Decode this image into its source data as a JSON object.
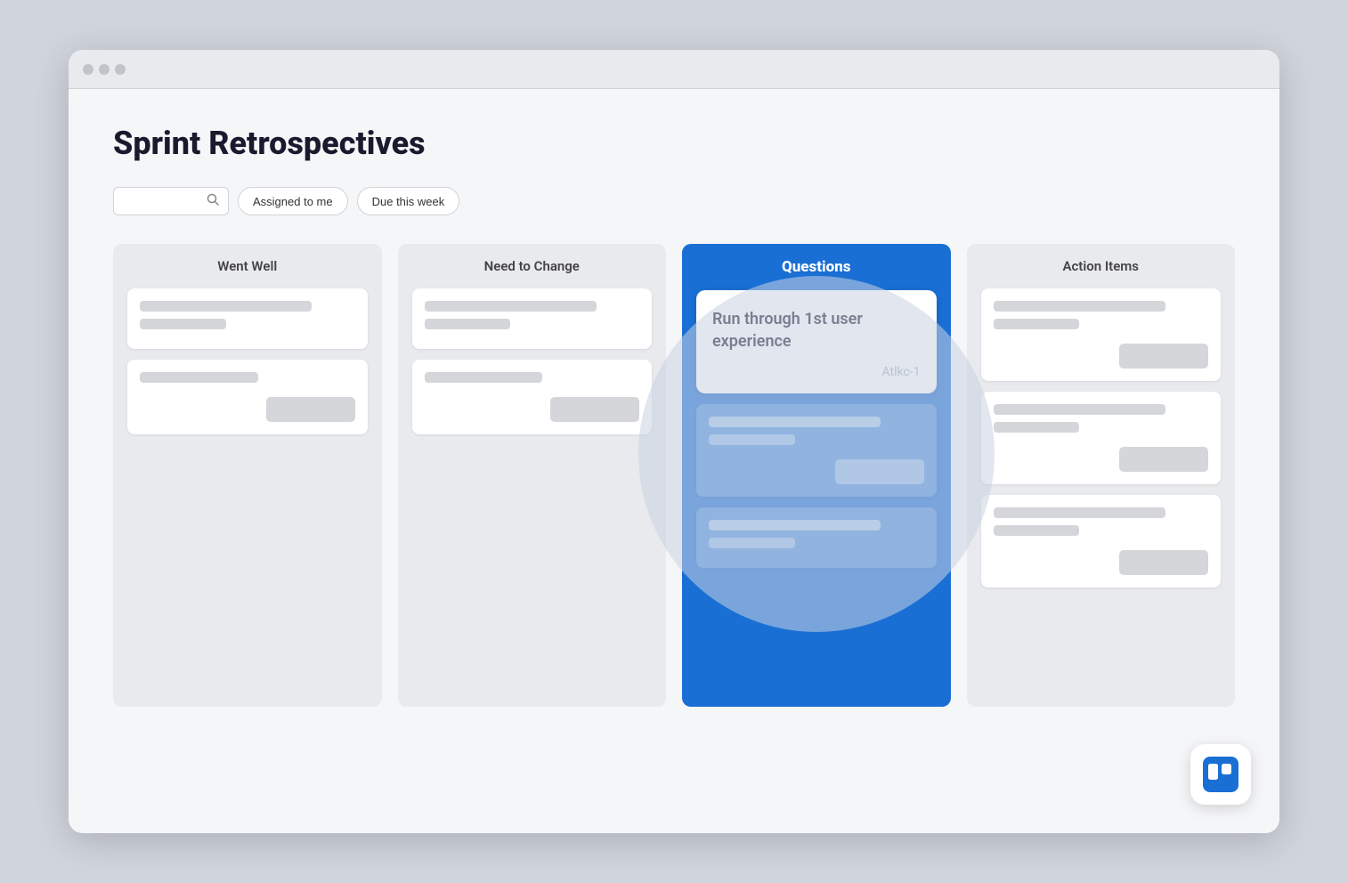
{
  "browser": {
    "dots": [
      "dot1",
      "dot2",
      "dot3"
    ]
  },
  "page": {
    "title": "Sprint Retrospectives"
  },
  "filters": {
    "search_placeholder": "Search",
    "assigned_label": "Assigned to me",
    "due_label": "Due this week"
  },
  "columns": {
    "went_well": {
      "header": "Went Well",
      "cards": [
        {
          "lines": [
            "long",
            "short"
          ],
          "has_btn": false
        },
        {
          "lines": [
            "medium"
          ],
          "has_btn": true
        }
      ]
    },
    "need_to_change": {
      "header": "Need to Change",
      "cards": [
        {
          "lines": [
            "long",
            "short"
          ],
          "has_btn": false
        },
        {
          "lines": [
            "medium"
          ],
          "has_btn": true
        }
      ]
    },
    "questions": {
      "header": "Questions",
      "featured_card": {
        "title": "Run through 1st user experience",
        "id": "Atlkc-1"
      },
      "cards": [
        {
          "lines": [
            "long",
            "short"
          ],
          "has_btn": true
        },
        {
          "lines": [
            "long",
            "short"
          ],
          "has_btn": false
        }
      ]
    },
    "action_items": {
      "header": "Action Items",
      "cards": [
        {
          "lines": [
            "long",
            "short"
          ],
          "has_btn": true
        },
        {
          "lines": [
            "long",
            "short"
          ],
          "has_btn": true
        },
        {
          "lines": [
            "long",
            "short"
          ],
          "has_btn": true
        }
      ]
    }
  },
  "trello": {
    "logo_color": "#1a6fd4"
  }
}
